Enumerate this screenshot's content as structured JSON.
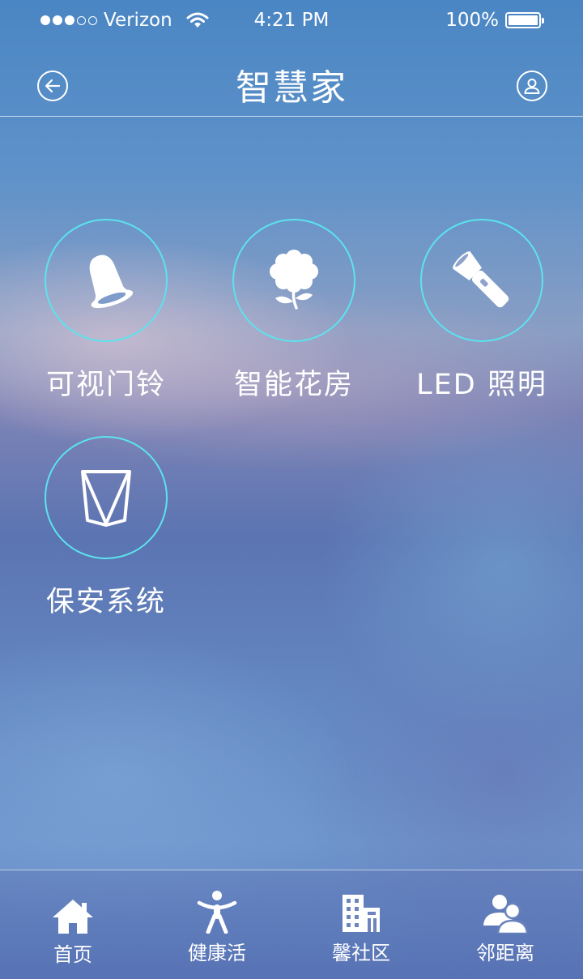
{
  "status_bar": {
    "carrier": "Verizon",
    "time": "4:21 PM",
    "battery": "100%",
    "battery_level": 1.0,
    "signal_filled": 3,
    "signal_total": 5
  },
  "nav": {
    "title": "智慧家",
    "back_icon": "arrow-left-circle-icon",
    "profile_icon": "user-circle-icon"
  },
  "features": [
    {
      "label": "可视门铃",
      "icon": "bell-icon"
    },
    {
      "label": "智能花房",
      "icon": "flower-icon"
    },
    {
      "label": "LED 照明",
      "icon": "flashlight-icon"
    },
    {
      "label": "保安系统",
      "icon": "shield-v-icon"
    }
  ],
  "tabs": [
    {
      "label": "首页",
      "icon": "home-icon"
    },
    {
      "label": "健康活",
      "icon": "person-icon"
    },
    {
      "label": "馨社区",
      "icon": "building-icon"
    },
    {
      "label": "邻距离",
      "icon": "users-icon"
    }
  ],
  "colors": {
    "ring": "#5ce3ee",
    "text": "#ffffff"
  }
}
